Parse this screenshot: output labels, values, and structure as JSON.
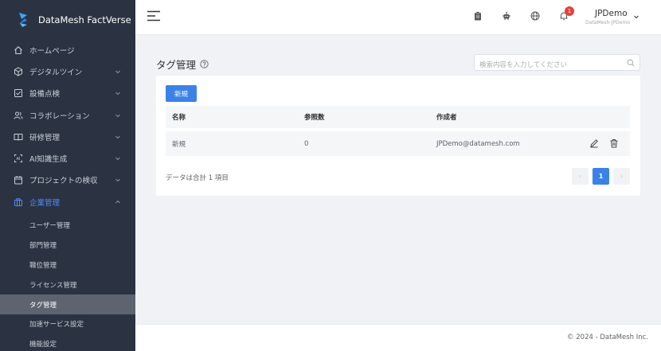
{
  "app": {
    "name": "DataMesh FactVerse"
  },
  "sidebar": {
    "items": [
      {
        "label": "ホームページ",
        "icon": "home-icon",
        "has_children": false
      },
      {
        "label": "デジタルツイン",
        "icon": "cube-icon",
        "has_children": true
      },
      {
        "label": "設備点検",
        "icon": "checkbox-icon",
        "has_children": true
      },
      {
        "label": "コラボレーション",
        "icon": "users-icon",
        "has_children": true
      },
      {
        "label": "研修管理",
        "icon": "book-icon",
        "has_children": true
      },
      {
        "label": "AI知識生成",
        "icon": "ai-icon",
        "has_children": true
      },
      {
        "label": "プロジェクトの検収",
        "icon": "calendar-icon",
        "has_children": true
      },
      {
        "label": "企業管理",
        "icon": "building-icon",
        "has_children": true,
        "expanded": true,
        "active": true
      }
    ],
    "sub_items": [
      {
        "label": "ユーザー管理",
        "active": false
      },
      {
        "label": "部門管理",
        "active": false
      },
      {
        "label": "職位管理",
        "active": false
      },
      {
        "label": "ライセンス管理",
        "active": false
      },
      {
        "label": "タグ管理",
        "active": true
      },
      {
        "label": "加速サービス設定",
        "active": false
      },
      {
        "label": "機能設定",
        "active": false
      }
    ]
  },
  "header": {
    "icons": [
      "clipboard-icon",
      "robot-icon",
      "globe-icon",
      "bell-icon"
    ],
    "notification_count": "1",
    "user": {
      "name": "JPDemo",
      "subtitle": "DataMesh-JPDemo"
    }
  },
  "main": {
    "title": "タグ管理",
    "search": {
      "placeholder": "検索内容を入力してください",
      "value": ""
    },
    "new_button": "新規",
    "table": {
      "columns": [
        "名称",
        "参照数",
        "作成者"
      ],
      "rows": [
        {
          "name": "新規",
          "ref_count": "0",
          "creator": "JPDemo@datamesh.com"
        }
      ]
    },
    "total_text": "データは合計 1 項目",
    "pagination": {
      "prev": "‹",
      "current": "1",
      "next": "›"
    }
  },
  "footer": {
    "copyright": "© 2024 - DataMesh Inc."
  },
  "colors": {
    "sidebar_bg": "#2b3342",
    "accent": "#3a82e8",
    "active_nav": "#4f8ef7",
    "badge": "#e6413a"
  }
}
